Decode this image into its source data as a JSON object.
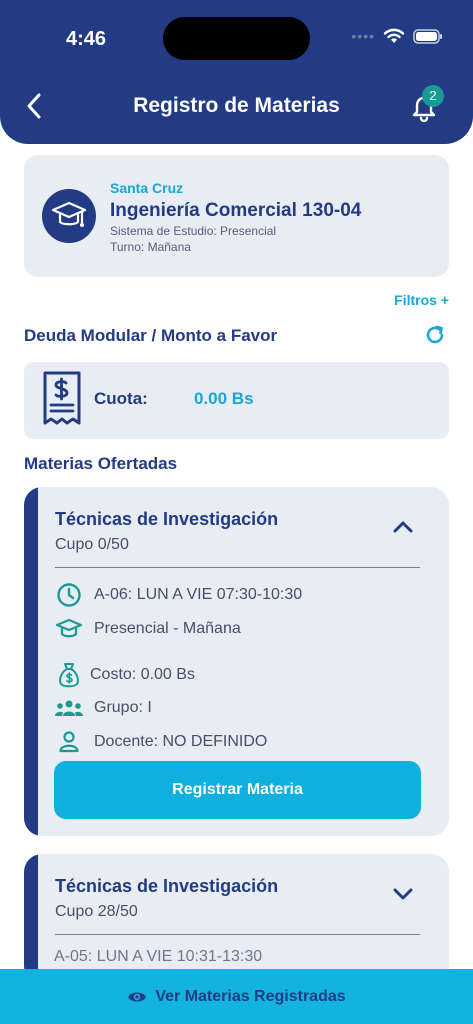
{
  "status": {
    "time": "4:46"
  },
  "header": {
    "title": "Registro de Materias",
    "notification_count": "2"
  },
  "career": {
    "campus": "Santa Cruz",
    "name": "Ingeniería Comercial 130-04",
    "system": "Sistema de Estudio: Presencial",
    "shift": "Turno: Mañana"
  },
  "filters_label": "Filtros +",
  "debt": {
    "section_title": "Deuda Modular / Monto a Favor",
    "cuota_label": "Cuota:",
    "cuota_value": "0.00 Bs"
  },
  "offered": {
    "section_title": "Materias Ofertadas",
    "courses": [
      {
        "title": "Técnicas de Investigación",
        "cupo": "Cupo 0/50",
        "schedule": "A-06: LUN A VIE 07:30-10:30",
        "modality": "Presencial - Mañana",
        "cost": "Costo: 0.00 Bs",
        "group": "Grupo: I",
        "teacher": "Docente:  NO DEFINIDO",
        "register_label": "Registrar Materia"
      },
      {
        "title": "Técnicas de Investigación",
        "cupo": "Cupo 28/50",
        "schedule_peek": "A-05: LUN A VIE 10:31-13:30"
      }
    ]
  },
  "bottom": {
    "label": "Ver Materias Registradas"
  },
  "colors": {
    "primary": "#233a85",
    "accent": "#12b3de",
    "card": "#e8ecf3",
    "teal": "#1a9a93"
  }
}
